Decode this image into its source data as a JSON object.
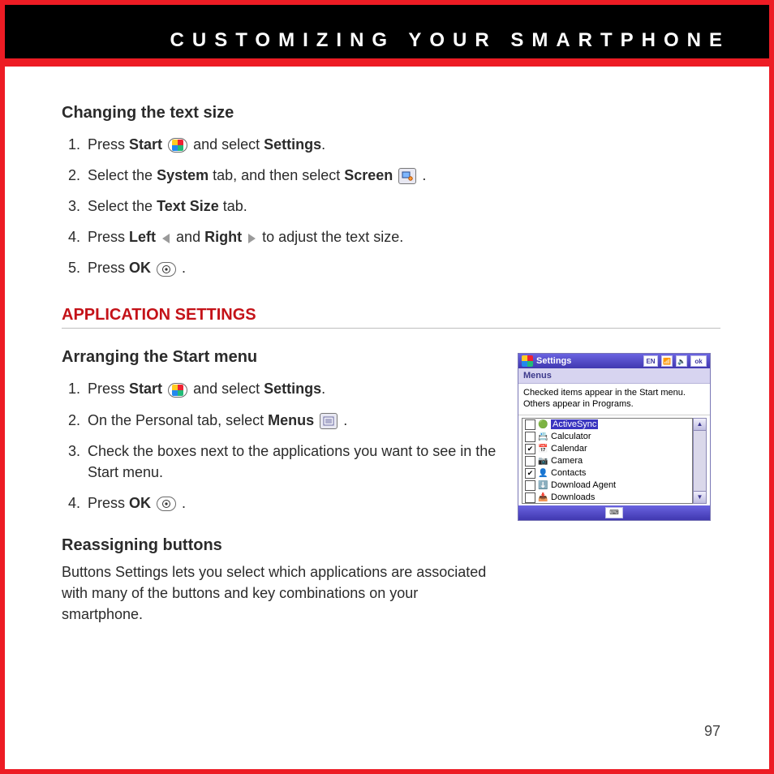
{
  "header": {
    "title": "CUSTOMIZING YOUR SMARTPHONE"
  },
  "sections": {
    "changing_text_size": {
      "title": "Changing the text size",
      "steps": {
        "s1a": "Press ",
        "s1b": "Start",
        "s1c": " and select ",
        "s1d": "Settings",
        "s1e": ".",
        "s2a": "Select the ",
        "s2b": "System",
        "s2c": " tab, and then select ",
        "s2d": "Screen",
        "s2e": " .",
        "s3a": "Select the ",
        "s3b": "Text Size",
        "s3c": " tab.",
        "s4a": "Press ",
        "s4b": "Left",
        "s4c": " and ",
        "s4d": "Right",
        "s4e": " to adjust the text size.",
        "s5a": "Press ",
        "s5b": "OK",
        "s5c": " ."
      }
    },
    "app_settings": {
      "title": "APPLICATION SETTINGS"
    },
    "arranging": {
      "title": "Arranging the Start menu",
      "steps": {
        "s1a": "Press ",
        "s1b": "Start",
        "s1c": " and select ",
        "s1d": "Settings",
        "s1e": ".",
        "s2a": "On the Personal tab, select ",
        "s2b": "Menus",
        "s2c": " .",
        "s3": "Check the boxes next to the applications you want to see in the Start menu.",
        "s4a": "Press ",
        "s4b": "OK",
        "s4c": " ."
      }
    },
    "reassigning": {
      "title": "Reassigning buttons",
      "body": "Buttons Settings lets you select which applications are associated with many of the buttons and key combinations on your smartphone."
    }
  },
  "screenshot": {
    "title": "Settings",
    "status": {
      "lang": "EN",
      "ok": "ok"
    },
    "subtitle": "Menus",
    "hint": "Checked items appear in the Start menu. Others appear in Programs.",
    "items": [
      {
        "label": "ActiveSync",
        "checked": false,
        "selected": true
      },
      {
        "label": "Calculator",
        "checked": false,
        "selected": false
      },
      {
        "label": "Calendar",
        "checked": true,
        "selected": false
      },
      {
        "label": "Camera",
        "checked": false,
        "selected": false
      },
      {
        "label": "Contacts",
        "checked": true,
        "selected": false
      },
      {
        "label": "Download Agent",
        "checked": false,
        "selected": false
      },
      {
        "label": "Downloads",
        "checked": false,
        "selected": false
      }
    ]
  },
  "page_number": "97"
}
